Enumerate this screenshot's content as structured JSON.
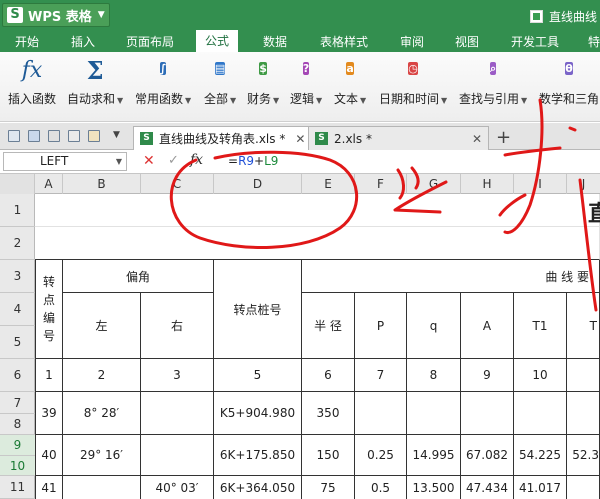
{
  "app": {
    "name": "WPS 表格",
    "logo": "S",
    "window_title": "直线曲线"
  },
  "menu": [
    "开始",
    "插入",
    "页面布局",
    "公式",
    "数据",
    "表格样式",
    "审阅",
    "视图",
    "开发工具",
    "特"
  ],
  "menu_active_index": 3,
  "ribbon": [
    {
      "label": "插入函数",
      "icon": "fx-icon",
      "caret": false
    },
    {
      "label": "自动求和",
      "icon": "sigma-icon",
      "caret": true
    },
    {
      "label": "常用函数",
      "icon": "common-func-icon",
      "caret": true,
      "color": "#2d6db7"
    },
    {
      "label": "全部",
      "icon": "all-func-icon",
      "caret": true,
      "color": "#2f77c9"
    },
    {
      "label": "财务",
      "icon": "finance-icon",
      "caret": true,
      "color": "#3f9a45"
    },
    {
      "label": "逻辑",
      "icon": "logic-icon",
      "caret": true,
      "color": "#a447b5"
    },
    {
      "label": "文本",
      "icon": "text-icon",
      "caret": true,
      "color": "#e38a1e"
    },
    {
      "label": "日期和时间",
      "icon": "datetime-icon",
      "caret": true,
      "color": "#d94545"
    },
    {
      "label": "查找与引用",
      "icon": "lookup-icon",
      "caret": true,
      "color": "#9b5cc6"
    },
    {
      "label": "数学和三角",
      "icon": "math-icon",
      "caret": false,
      "color": "#7a64c8"
    }
  ],
  "tabs": [
    {
      "label": "直线曲线及转角表.xls *",
      "active": true
    },
    {
      "label": "2.xls *",
      "active": false
    }
  ],
  "formula_bar": {
    "name_box": "LEFT",
    "formula_prefix": "=",
    "ref1": "R9",
    "operator": "+",
    "ref2": "L9"
  },
  "columns": [
    "A",
    "B",
    "C",
    "D",
    "E",
    "F",
    "G",
    "H",
    "I",
    "J"
  ],
  "rows": [
    "1",
    "2",
    "3",
    "4",
    "5",
    "6",
    "7",
    "8",
    "9",
    "10",
    "11"
  ],
  "selected_rows": [
    "9",
    "10"
  ],
  "sheet": {
    "title_fragment": "直",
    "h_turn_no": "转点编号",
    "h_angle": "偏角",
    "h_left": "左",
    "h_right": "右",
    "h_station": "转点桩号",
    "h_curve": "曲 线 要",
    "h_radius": "半 径",
    "h_p": "P",
    "h_q": "q",
    "h_a": "A",
    "h_t1": "T1",
    "h_t": "T",
    "index_row": [
      "1",
      "2",
      "3",
      "5",
      "6",
      "7",
      "8",
      "9",
      "10"
    ],
    "rows": [
      {
        "no": "39",
        "left": "8° 28′",
        "right": "",
        "station": "K5+904.980",
        "radius": "350",
        "p": "",
        "q": "",
        "a": "",
        "t1": "",
        "t": ""
      },
      {
        "no": "40",
        "left": "29° 16′",
        "right": "",
        "station": "6K+175.850",
        "radius": "150",
        "p": "0.25",
        "q": "14.995",
        "a": "67.082",
        "t1": "54.225",
        "t": "52.3"
      },
      {
        "no": "41",
        "left": "",
        "right": "40° 03′",
        "station": "6K+364.050",
        "radius": "75",
        "p": "0.5",
        "q": "13.500",
        "a": "47.434",
        "t1": "41.017",
        "t": ""
      }
    ]
  }
}
